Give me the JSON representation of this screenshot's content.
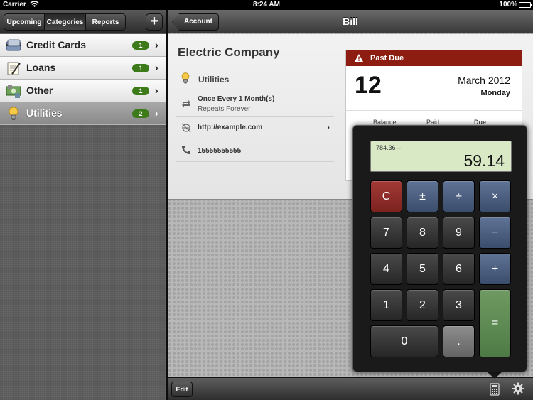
{
  "status_bar": {
    "carrier": "Carrier",
    "time": "8:24 AM",
    "battery": "100%"
  },
  "left_toolbar": {
    "tabs": [
      {
        "label": "Upcoming"
      },
      {
        "label": "Categories"
      },
      {
        "label": "Reports"
      }
    ],
    "add_label": "+"
  },
  "categories": [
    {
      "label": "Credit Cards",
      "count": "1",
      "icon": "credit-card-icon"
    },
    {
      "label": "Loans",
      "count": "1",
      "icon": "loan-document-icon"
    },
    {
      "label": "Other",
      "count": "1",
      "icon": "money-icon"
    },
    {
      "label": "Utilities",
      "count": "2",
      "icon": "lightbulb-icon"
    }
  ],
  "nav": {
    "back_label": "Account",
    "title": "Bill"
  },
  "bill": {
    "payee": "Electric Company",
    "category": "Utilities",
    "repeat_title": "Once Every 1 Month(s)",
    "repeat_sub": "Repeats Forever",
    "url": "http://example.com",
    "phone": "15555555555"
  },
  "due": {
    "banner": "Past Due",
    "day": "12",
    "month_year": "March 2012",
    "weekday": "Monday",
    "columns": [
      "Balance",
      "Paid",
      "Due"
    ]
  },
  "calculator": {
    "expression": "784.36 –",
    "value": "59.14",
    "keys": {
      "clear": "C",
      "plus_minus": "±",
      "divide": "÷",
      "multiply": "×",
      "seven": "7",
      "eight": "8",
      "nine": "9",
      "minus": "−",
      "four": "4",
      "five": "5",
      "six": "6",
      "plus": "+",
      "one": "1",
      "two": "2",
      "three": "3",
      "equals": "=",
      "zero": "0",
      "dot": "."
    }
  },
  "bottom_toolbar": {
    "edit_label": "Edit"
  },
  "colors": {
    "past_due": "#8c1d10",
    "count_badge": "#3c7a1a",
    "display": "#d9e9c6"
  }
}
